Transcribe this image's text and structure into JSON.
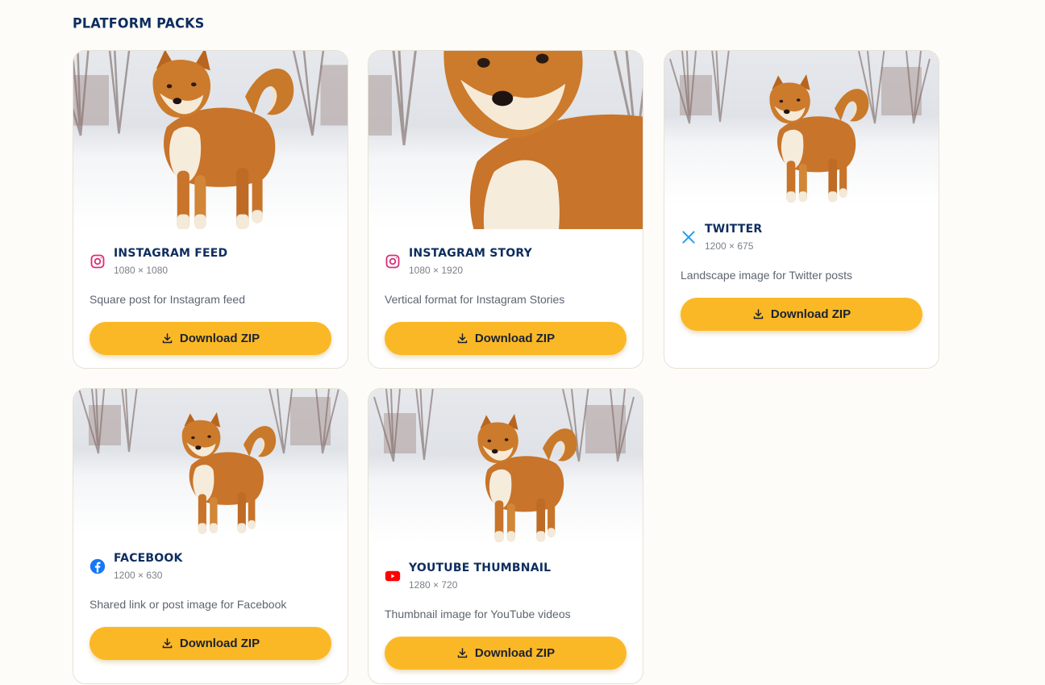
{
  "section": {
    "title": "PLATFORM PACKS"
  },
  "cards": [
    {
      "title": "INSTAGRAM FEED",
      "dims": "1080 × 1080",
      "desc": "Square post for Instagram feed",
      "button": "Download ZIP",
      "icon": "instagram-icon"
    },
    {
      "title": "INSTAGRAM STORY",
      "dims": "1080 × 1920",
      "desc": "Vertical format for Instagram Stories",
      "button": "Download ZIP",
      "icon": "instagram-icon"
    },
    {
      "title": "TWITTER",
      "dims": "1200 × 675",
      "desc": "Landscape image for Twitter posts",
      "button": "Download ZIP",
      "icon": "x-twitter-icon"
    },
    {
      "title": "FACEBOOK",
      "dims": "1200 × 630",
      "desc": "Shared link or post image for Facebook",
      "button": "Download ZIP",
      "icon": "facebook-icon"
    },
    {
      "title": "YOUTUBE THUMBNAIL",
      "dims": "1280 × 720",
      "desc": "Thumbnail image for YouTube videos",
      "button": "Download ZIP",
      "icon": "youtube-icon"
    }
  ],
  "colors": {
    "accent": "#fbb826",
    "heading": "#0d2d5e",
    "instagram": "#d6307a",
    "twitter": "#1d9bf0",
    "facebook": "#1877f2",
    "youtube": "#ff0000"
  }
}
